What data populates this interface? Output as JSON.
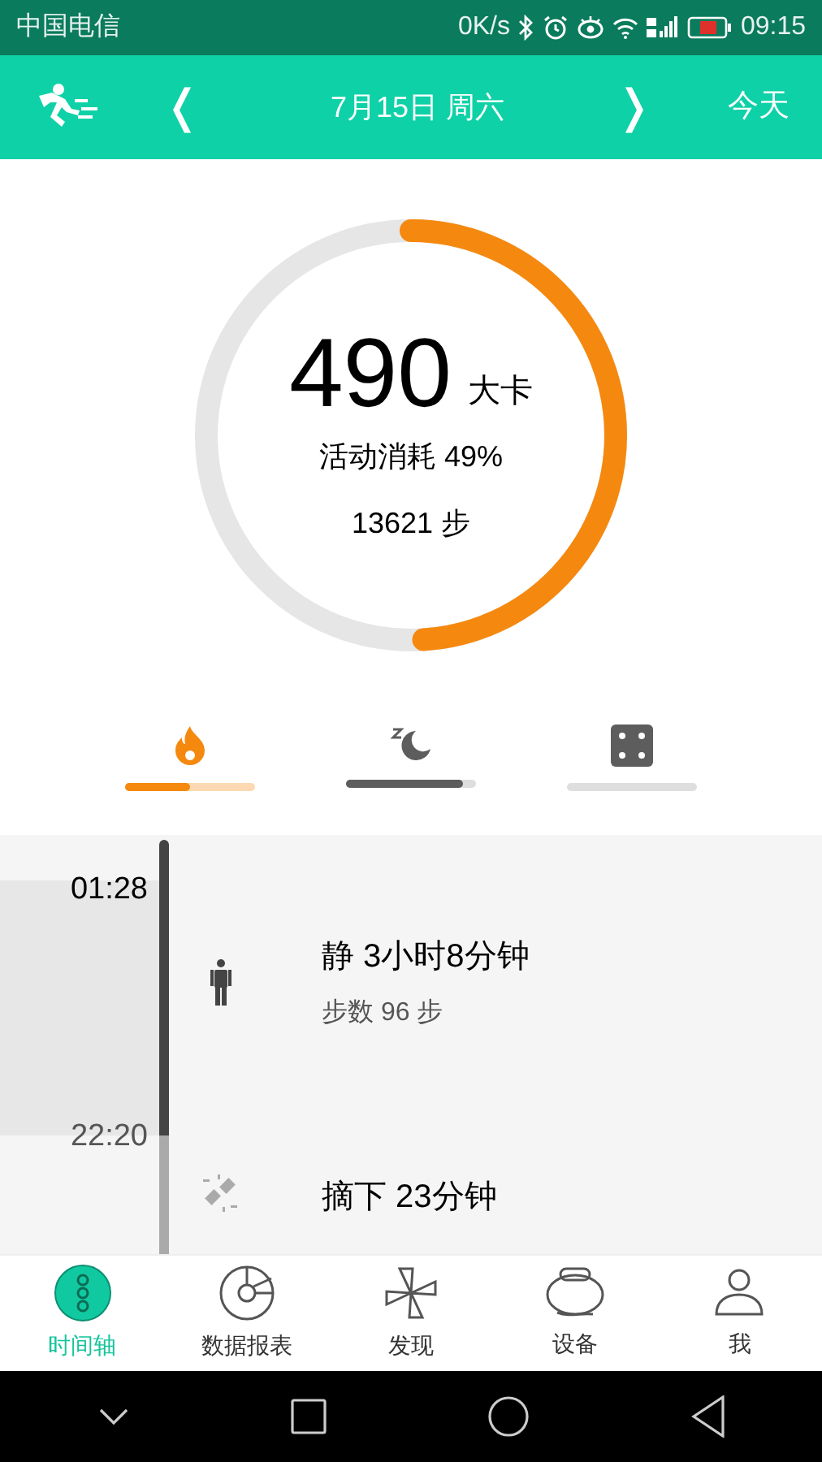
{
  "status_bar": {
    "carrier": "中国电信",
    "speed": "0K/s",
    "time": "09:15"
  },
  "header": {
    "prev": "❬",
    "date": "7月15日 周六",
    "next": "❭",
    "today": "今天"
  },
  "summary": {
    "value": "490",
    "unit": "大卡",
    "level": 0.49,
    "activity": "活动消耗 49%",
    "steps": "13621 步"
  },
  "metric_tabs": [
    {
      "kind": "calories",
      "selected": true,
      "level": 0.5
    },
    {
      "kind": "sleep",
      "selected": false,
      "level": 0.9
    },
    {
      "kind": "other",
      "selected": false
    }
  ],
  "timeline": {
    "times": [
      "01:28",
      "22:20"
    ],
    "entries": [
      {
        "kind": "still",
        "title": "静 3小时8分钟",
        "detail": "步数 96 步"
      },
      {
        "kind": "removed",
        "title": "摘下 23分钟"
      }
    ]
  },
  "bottom_nav": [
    {
      "kind": "timeline",
      "label": "时间轴",
      "selected": true
    },
    {
      "kind": "reports",
      "label": "数据报表",
      "selected": false
    },
    {
      "kind": "discover",
      "label": "发现",
      "selected": false
    },
    {
      "kind": "device",
      "label": "设备",
      "selected": false
    },
    {
      "kind": "me",
      "label": "我",
      "selected": false
    }
  ]
}
